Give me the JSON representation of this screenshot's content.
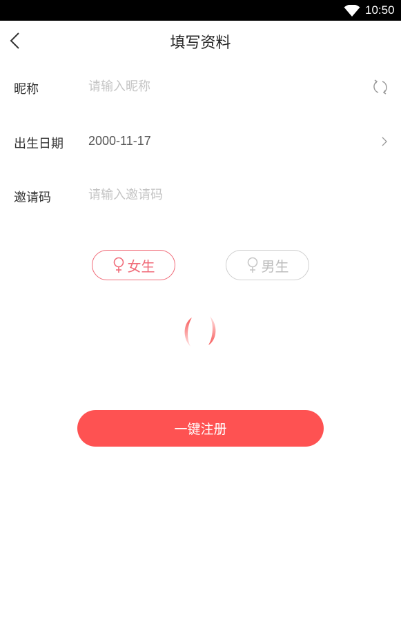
{
  "status_bar": {
    "time": "10:50",
    "wifi_icon": "wifi-icon"
  },
  "header": {
    "title": "填写资料",
    "back_icon": "chevron-left-icon"
  },
  "form": {
    "nickname": {
      "label": "昵称",
      "placeholder": "请输入昵称",
      "value": "",
      "action_icon": "refresh-icon"
    },
    "birthday": {
      "label": "出生日期",
      "value": "2000-11-17",
      "action_icon": "chevron-right-icon"
    },
    "invite_code": {
      "label": "邀请码",
      "placeholder": "请输入邀请码",
      "value": ""
    }
  },
  "gender": {
    "options": [
      {
        "label": "女生",
        "icon": "female-icon",
        "selected": true
      },
      {
        "label": "男生",
        "icon": "female-icon",
        "selected": false
      }
    ]
  },
  "loading": {
    "icon": "loading-spinner-icon"
  },
  "actions": {
    "register_label": "一键注册"
  },
  "colors": {
    "accent": "#fe5252",
    "selected_outline": "#f06a78",
    "unselected_outline": "#cfcfcf",
    "placeholder": "#c4c4c4"
  }
}
